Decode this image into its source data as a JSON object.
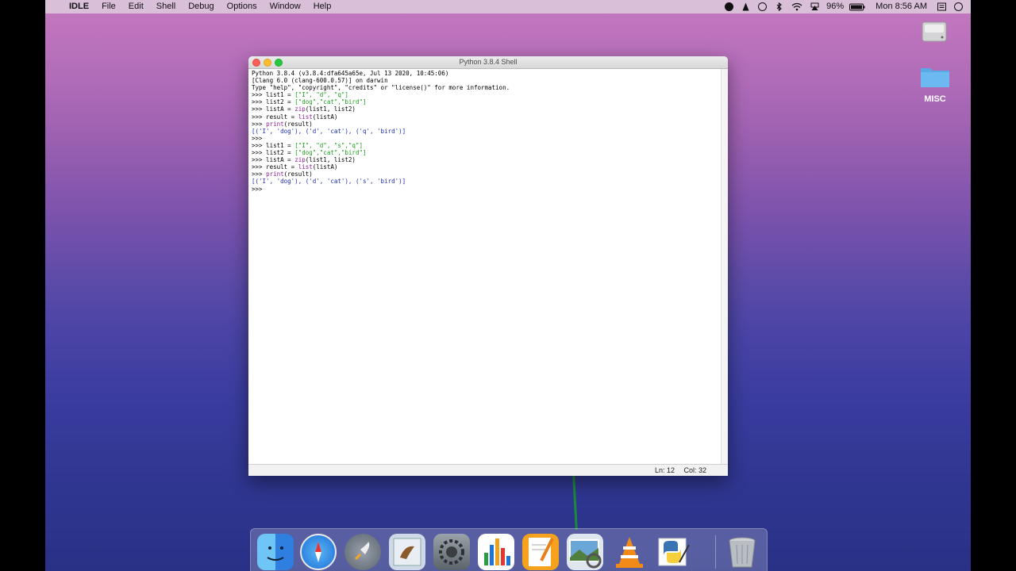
{
  "menubar": {
    "apple_glyph": "",
    "app_name": "IDLE",
    "menus": [
      "File",
      "Edit",
      "Shell",
      "Debug",
      "Options",
      "Window",
      "Help"
    ],
    "battery": "96%",
    "clock": "Mon 8:56 AM"
  },
  "desktop": {
    "folder_label": "MISC"
  },
  "window": {
    "title": "Python 3.8.4 Shell"
  },
  "shell": {
    "lines": [
      {
        "segs": [
          {
            "t": "Python 3.8.4 (v3.8.4:dfa645a65e, Jul 13 2020, 10:45:06)",
            "c": ""
          }
        ]
      },
      {
        "segs": [
          {
            "t": "[Clang 6.0 (clang-600.0.57)] on darwin",
            "c": ""
          }
        ]
      },
      {
        "segs": [
          {
            "t": "Type \"help\", \"copyright\", \"credits\" or \"license()\" for more information.",
            "c": ""
          }
        ]
      },
      {
        "segs": [
          {
            "t": ">>> list1 = ",
            "c": ""
          },
          {
            "t": "[\"I\", \"d\", \"q\"]",
            "c": "str"
          }
        ]
      },
      {
        "segs": [
          {
            "t": ">>> list2 = ",
            "c": ""
          },
          {
            "t": "[\"dog\",\"cat\",\"bird\"]",
            "c": "str"
          }
        ]
      },
      {
        "segs": [
          {
            "t": ">>> listA = ",
            "c": ""
          },
          {
            "t": "zip",
            "c": "bi"
          },
          {
            "t": "(list1, list2)",
            "c": ""
          }
        ]
      },
      {
        "segs": [
          {
            "t": ">>> result = ",
            "c": ""
          },
          {
            "t": "list",
            "c": "bi"
          },
          {
            "t": "(listA)",
            "c": ""
          }
        ]
      },
      {
        "segs": [
          {
            "t": ">>> ",
            "c": ""
          },
          {
            "t": "print",
            "c": "bi"
          },
          {
            "t": "(result)",
            "c": ""
          }
        ]
      },
      {
        "segs": [
          {
            "t": "[('I', 'dog'), ('d', 'cat'), ('q', 'bird')]",
            "c": "out"
          }
        ]
      },
      {
        "segs": [
          {
            "t": ">>>",
            "c": ""
          }
        ]
      },
      {
        "segs": [
          {
            "t": ">>> list1 = ",
            "c": ""
          },
          {
            "t": "[\"I\", \"d\", \"s\",\"q\"]",
            "c": "str"
          }
        ]
      },
      {
        "segs": [
          {
            "t": ">>> list2 = ",
            "c": ""
          },
          {
            "t": "[\"dog\",\"cat\",\"bird\"]",
            "c": "str"
          }
        ]
      },
      {
        "segs": [
          {
            "t": ">>> listA = ",
            "c": ""
          },
          {
            "t": "zip",
            "c": "bi"
          },
          {
            "t": "(list1, list2)",
            "c": ""
          }
        ]
      },
      {
        "segs": [
          {
            "t": ">>> result = ",
            "c": ""
          },
          {
            "t": "list",
            "c": "bi"
          },
          {
            "t": "(listA)",
            "c": ""
          }
        ]
      },
      {
        "segs": [
          {
            "t": ">>> ",
            "c": ""
          },
          {
            "t": "print",
            "c": "bi"
          },
          {
            "t": "(result)",
            "c": ""
          }
        ]
      },
      {
        "segs": [
          {
            "t": "[('I', 'dog'), ('d', 'cat'), ('s', 'bird')]",
            "c": "out"
          }
        ]
      },
      {
        "segs": [
          {
            "t": ">>>",
            "c": ""
          }
        ]
      }
    ]
  },
  "statusbar": {
    "line": "Ln: 12",
    "col": "Col: 32"
  },
  "colors": {
    "string": "#1c9b1c",
    "builtin": "#8d1a9a",
    "output": "#1b2db0"
  },
  "dock": {
    "apps": [
      "finder-icon",
      "safari-icon",
      "launchpad-icon",
      "mail-icon",
      "system-preferences-icon",
      "numbers-icon",
      "pages-icon",
      "preview-icon",
      "vlc-icon",
      "python-launcher-icon",
      "trash-icon"
    ]
  }
}
